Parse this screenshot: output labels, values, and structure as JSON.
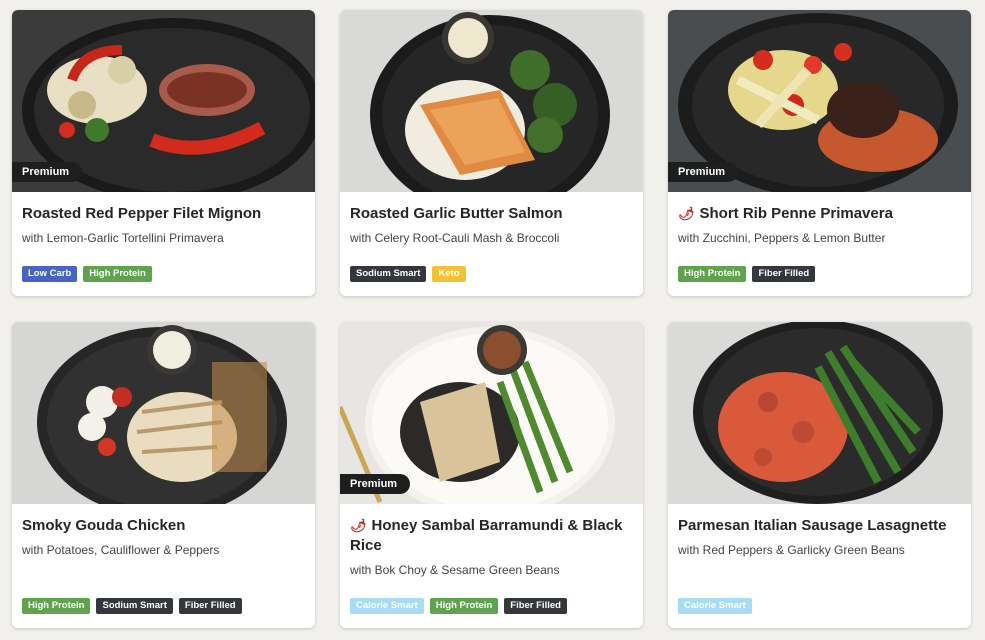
{
  "meals": [
    {
      "title": "Roasted Red Pepper Filet Mignon",
      "subtitle": "with Lemon-Garlic Tortellini Primavera",
      "badge": "Premium",
      "spicy": false,
      "tags": [
        {
          "label": "Low Carb",
          "color": "#4763c4",
          "text": "#ffffff"
        },
        {
          "label": "High Protein",
          "color": "#5fa34e",
          "text": "#ffffff"
        }
      ]
    },
    {
      "title": "Roasted Garlic Butter Salmon",
      "subtitle": "with Celery Root-Cauli Mash & Broccoli",
      "badge": "",
      "spicy": false,
      "tags": [
        {
          "label": "Sodium Smart",
          "color": "#34383d",
          "text": "#ffffff"
        },
        {
          "label": "Keto",
          "color": "#f2c234",
          "text": "#ffffff"
        }
      ]
    },
    {
      "title": "Short Rib Penne Primavera",
      "subtitle": "with Zucchini, Peppers & Lemon Butter",
      "badge": "Premium",
      "spicy": true,
      "tags": [
        {
          "label": "High Protein",
          "color": "#5fa34e",
          "text": "#ffffff"
        },
        {
          "label": "Fiber Filled",
          "color": "#34383d",
          "text": "#ffffff"
        }
      ]
    },
    {
      "title": "Smoky Gouda Chicken",
      "subtitle": "with Potatoes, Cauliflower & Peppers",
      "badge": "",
      "spicy": false,
      "tags": [
        {
          "label": "High Protein",
          "color": "#5fa34e",
          "text": "#ffffff"
        },
        {
          "label": "Sodium Smart",
          "color": "#34383d",
          "text": "#ffffff"
        },
        {
          "label": "Fiber Filled",
          "color": "#34383d",
          "text": "#ffffff"
        }
      ]
    },
    {
      "title": "Honey Sambal Barramundi & Black Rice",
      "subtitle": "with Bok Choy & Sesame Green Beans",
      "badge": "Premium",
      "spicy": true,
      "tags": [
        {
          "label": "Calorie Smart",
          "color": "#a7dcf4",
          "text": "#ffffff"
        },
        {
          "label": "High Protein",
          "color": "#5fa34e",
          "text": "#ffffff"
        },
        {
          "label": "Fiber Filled",
          "color": "#34383d",
          "text": "#ffffff"
        }
      ]
    },
    {
      "title": "Parmesan Italian Sausage Lasagnette",
      "subtitle": "with Red Peppers & Garlicky Green Beans",
      "badge": "",
      "spicy": false,
      "tags": [
        {
          "label": "Calorie Smart",
          "color": "#a7dcf4",
          "text": "#ffffff"
        }
      ]
    }
  ],
  "icons": {
    "spicy": "chili-pepper-icon"
  }
}
